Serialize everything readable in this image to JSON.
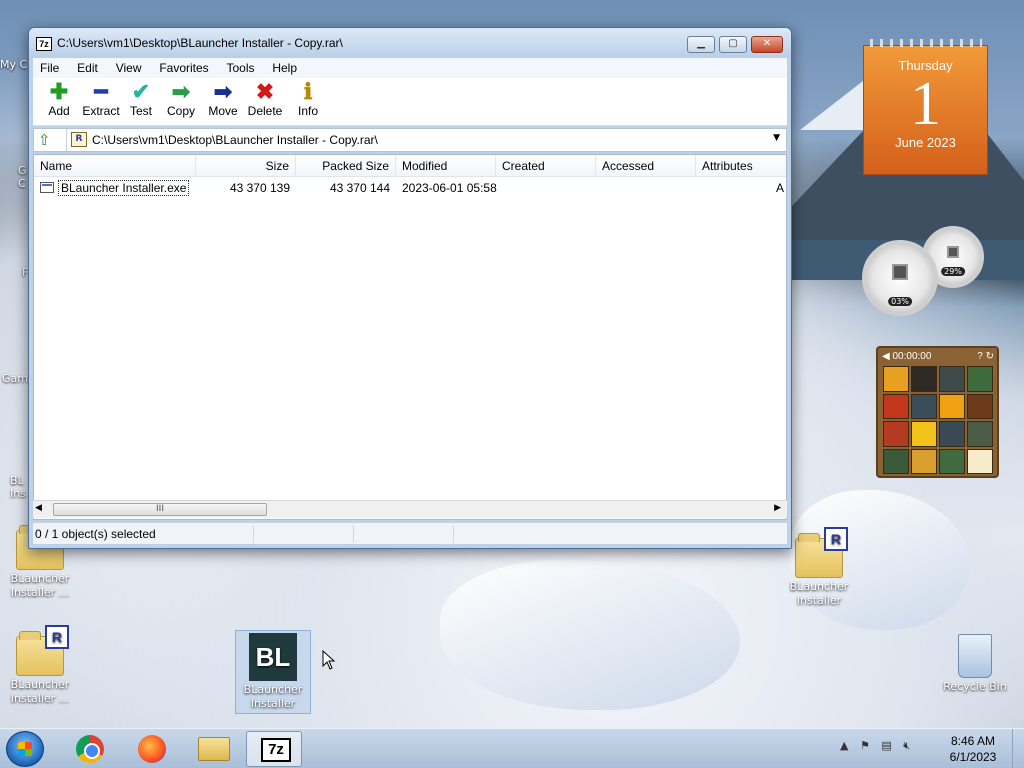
{
  "window": {
    "title": "C:\\Users\\vm1\\Desktop\\BLauncher Installer - Copy.rar\\",
    "icon": "7z",
    "min_label": "▁",
    "max_label": "▢",
    "close_label": "✕"
  },
  "menu": [
    "File",
    "Edit",
    "View",
    "Favorites",
    "Tools",
    "Help"
  ],
  "toolbar": {
    "add": {
      "label": "Add",
      "glyph": "✚",
      "color": "#1ea01e"
    },
    "extract": {
      "label": "Extract",
      "glyph": "━",
      "color": "#1d3fb0"
    },
    "test": {
      "label": "Test",
      "glyph": "✔",
      "color": "#26b3a3"
    },
    "copy": {
      "label": "Copy",
      "glyph": "➡",
      "color": "#2a9d4a"
    },
    "move": {
      "label": "Move",
      "glyph": "➡",
      "color": "#1d2f8c"
    },
    "delete": {
      "label": "Delete",
      "glyph": "✖",
      "color": "#d11a1a"
    },
    "info": {
      "label": "Info",
      "glyph": "ℹ",
      "color": "#b88a00"
    }
  },
  "address": {
    "path": "C:\\Users\\vm1\\Desktop\\BLauncher Installer - Copy.rar\\",
    "archive_icon": "R"
  },
  "columns": [
    "Name",
    "Size",
    "Packed Size",
    "Modified",
    "Created",
    "Accessed",
    "Attributes"
  ],
  "files": [
    {
      "name": "BLauncher Installer.exe",
      "size": "43 370 139",
      "packed": "43 370 144",
      "modified": "2023-06-01 05:58",
      "created": "",
      "accessed": "",
      "attributes": "A"
    }
  ],
  "scrollbar": {
    "thumb": "III"
  },
  "status": {
    "selection": "0 / 1 object(s) selected"
  },
  "calendar": {
    "weekday": "Thursday",
    "day": "1",
    "month": "June 2023"
  },
  "gauges": {
    "cpu": "03%",
    "mem": "29%"
  },
  "puzzle": {
    "timer": "00:00:00"
  },
  "desktop_icons": {
    "left_partial_1": "My C",
    "left_partial_2": "G\nC",
    "left_partial_3": "F",
    "left_partial_4": "Gam",
    "left_partial_5": "BL\nIns",
    "folder_left_1": "BLauncher Installer ...",
    "folder_left_2": "BLauncher Installer ...",
    "app_installer": "BLauncher Installer",
    "folder_right": "BLauncher Installer",
    "recycle": "Recycle Bin"
  },
  "taskbar": {
    "time": "8:46 AM",
    "date": "6/1/2023",
    "sevenz": "7z"
  },
  "colors": {
    "accent": "#3a6ea5",
    "calendar": "#e77b2a"
  }
}
